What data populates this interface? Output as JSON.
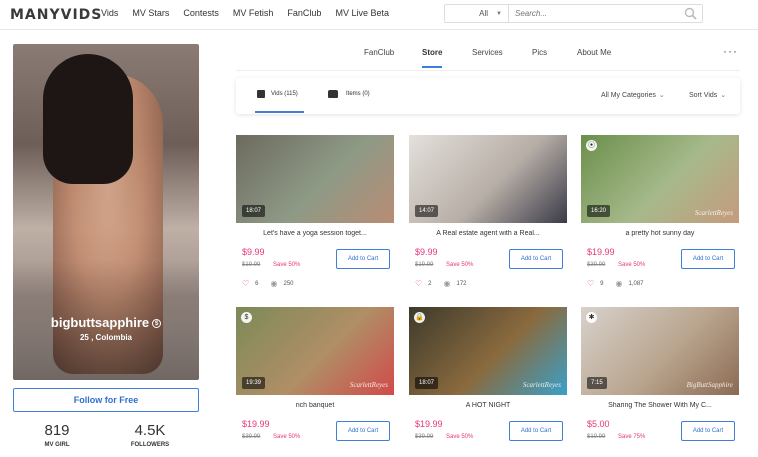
{
  "header": {
    "logo": "MANYVIDS",
    "nav": [
      "Vids",
      "MV Stars",
      "Contests",
      "MV Fetish",
      "FanClub",
      "MV Live Beta"
    ],
    "search_category": "All",
    "search_placeholder": "Search..."
  },
  "profile": {
    "username": "bigbuttsapphire",
    "location": "25 , Colombia",
    "follow_label": "Follow for Free",
    "stats": [
      {
        "value": "819",
        "label": "MV GIRL"
      },
      {
        "value": "4.5K",
        "label": "FOLLOWERS"
      }
    ]
  },
  "tabs": [
    "FanClub",
    "Store",
    "Services",
    "Pics",
    "About Me"
  ],
  "active_tab": "Store",
  "filter": {
    "vids_label": "Vids (115)",
    "items_label": "Items (0)",
    "categories_label": "All My Categories",
    "sort_label": "Sort Vids"
  },
  "cart_label": "Add to Cart",
  "videos": [
    {
      "title": "Let's have a yoga session toget...",
      "duration": "18:07",
      "price": "$9.99",
      "orig": "$19.99",
      "save": "Save 50%",
      "likes": "6",
      "views": "250",
      "badge": "",
      "watermark": "",
      "colors": [
        "#6d6a5e",
        "#8e9a86",
        "#b98c74"
      ]
    },
    {
      "title": "A Real estate agent with a Real...",
      "duration": "14:07",
      "price": "$9.99",
      "orig": "$19.99",
      "save": "Save 50%",
      "likes": "2",
      "views": "172",
      "badge": "",
      "watermark": "",
      "colors": [
        "#e4e0dc",
        "#b7aea6",
        "#3a3a48"
      ]
    },
    {
      "title": "a pretty hot sunny day",
      "duration": "16:20",
      "price": "$19.99",
      "orig": "$39.99",
      "save": "Save 50%",
      "likes": "9",
      "views": "1,087",
      "badge": "⦿",
      "watermark": "ScarlettReyes",
      "colors": [
        "#6b8f4c",
        "#a6b98a",
        "#c69a7e"
      ]
    },
    {
      "title": "rich banquet",
      "duration": "19:39",
      "price": "$19.99",
      "orig": "$39.99",
      "save": "Save 50%",
      "likes": "",
      "views": "",
      "badge": "$",
      "watermark": "ScarlettReyes",
      "colors": [
        "#7c8a58",
        "#b08e66",
        "#d24a4a"
      ]
    },
    {
      "title": "A HOT NIGHT",
      "duration": "18:07",
      "price": "$19.99",
      "orig": "$39.99",
      "save": "Save 50%",
      "likes": "",
      "views": "",
      "badge": "🔒",
      "watermark": "ScarlettReyes",
      "colors": [
        "#3d3a2c",
        "#8a6a3e",
        "#3aa0c8"
      ]
    },
    {
      "title": "Sharing The Shower With My C...",
      "duration": "7:15",
      "price": "$5.00",
      "orig": "$19.99",
      "save": "Save 75%",
      "likes": "",
      "views": "",
      "badge": "✱",
      "watermark": "BigButtSapphire",
      "colors": [
        "#d7d2cc",
        "#b9a48e",
        "#8c6a52"
      ]
    }
  ]
}
